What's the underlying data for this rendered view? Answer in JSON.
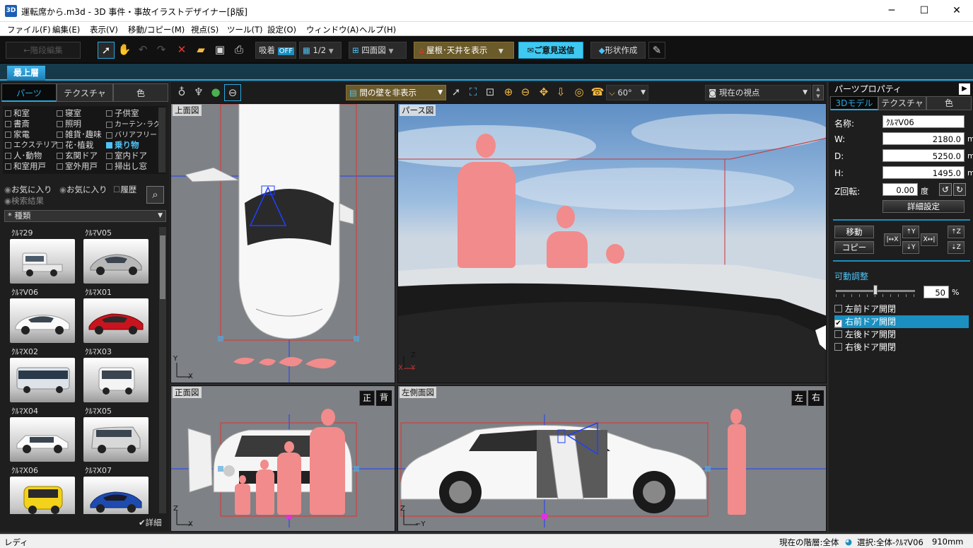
{
  "window": {
    "title": "運転席から.m3d - 3D 事件・事故イラストデザイナー[β版]",
    "icon": "3D",
    "minimize": "─",
    "maximize": "☐",
    "close": "✕"
  },
  "menu": [
    "ファイル(F)",
    "編集(E)",
    "表示(V)",
    "移動/コピー(M)",
    "視点(S)",
    "ツール(T)",
    "設定(O)",
    "ウィンドウ(A)",
    "ヘルプ(H)"
  ],
  "toolbar": {
    "back_label": "←階段編集",
    "snap_label": "吸着",
    "snap_state": "OFF",
    "grid_label": "1/2",
    "view_mode": "四面図",
    "roof_toggle": "屋根･天井を表示",
    "feedback": "ご意見送信",
    "shape_create": "形状作成"
  },
  "floor_tab": "最上層",
  "left_panel": {
    "tabs": [
      "パーツ",
      "テクスチャ",
      "色"
    ],
    "active_tab": "パーツ",
    "categories": [
      [
        "和室",
        "寝室",
        "子供室"
      ],
      [
        "書斎",
        "照明",
        "カーテン･ラグ"
      ],
      [
        "家電",
        "雑貨･趣味",
        "バリアフリー"
      ],
      [
        "エクステリア",
        "花･植栽",
        "乗り物"
      ],
      [
        "人･動物",
        "玄関ドア",
        "室内ドア"
      ],
      [
        "和室用戸",
        "室外用戸",
        "掃出し窓"
      ]
    ],
    "selected_category": "乗り物",
    "filters": [
      "お気に入り",
      "お気に入り",
      "履歴"
    ],
    "search_result": "検索結果",
    "sort_label": "* 種類",
    "items": [
      "ｸﾙﾏ29",
      "ｸﾙﾏV05",
      "ｸﾙﾏV06",
      "ｸﾙﾏX01",
      "ｸﾙﾏX02",
      "ｸﾙﾏX03",
      "ｸﾙﾏX04",
      "ｸﾙﾏX05",
      "ｸﾙﾏX06",
      "ｸﾙﾏX07"
    ],
    "detail_label": "詳細"
  },
  "viewport_toolbar": {
    "wall_toggle": "間の壁を非表示",
    "fov": "60°",
    "camera_view": "現在の視点"
  },
  "viewports": {
    "top": "上面図",
    "perspective": "パース図",
    "front": "正面図",
    "left": "左側面図",
    "front_toggle": [
      "正",
      "背"
    ],
    "side_toggle": [
      "左",
      "右"
    ],
    "axis_top": [
      "Y",
      "X"
    ],
    "axis_front": [
      "Z",
      "X"
    ],
    "axis_side": [
      "Z",
      "−Y"
    ],
    "axis_persp": [
      "Z",
      "X",
      "Y"
    ]
  },
  "right_panel": {
    "title": "パーツプロパティ",
    "tabs": [
      "3Dモデル",
      "テクスチャ",
      "色"
    ],
    "name_label": "名称:",
    "name_value": "ｸﾙﾏV06",
    "w_label": "W:",
    "w_value": "2180.0",
    "d_label": "D:",
    "d_value": "5250.0",
    "h_label": "H:",
    "h_value": "1495.0",
    "unit": "mm",
    "rot_label": "Z回転:",
    "rot_value": "0.00",
    "rot_unit": "度",
    "detail_button": "詳細設定",
    "move_button": "移動",
    "copy_button": "コピー",
    "movable_label": "可動調整",
    "movable_value": "50",
    "movable_unit": "%",
    "doors": [
      "左前ドア開閉",
      "右前ドア開閉",
      "左後ドア開閉",
      "右後ドア開閉"
    ],
    "doors_checked": [
      false,
      true,
      false,
      false
    ]
  },
  "status": {
    "left": "レディ",
    "floor": "現在の階層:全体",
    "selection": "選択:全体-ｸﾙﾏV06",
    "size": "910mm"
  }
}
